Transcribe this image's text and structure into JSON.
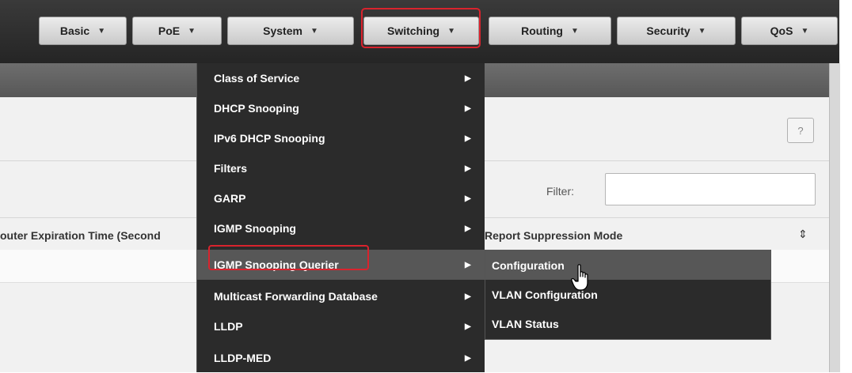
{
  "nav": {
    "tabs": [
      {
        "label": "Basic"
      },
      {
        "label": "PoE"
      },
      {
        "label": "System"
      },
      {
        "label": "Switching"
      },
      {
        "label": "Routing"
      },
      {
        "label": "Security"
      },
      {
        "label": "QoS"
      }
    ],
    "caret_icon": "caret-down-icon"
  },
  "page": {
    "help_label": "?",
    "filter_label": "Filter:",
    "filter_value": "",
    "columns": [
      {
        "label": "outer Expiration Time (Second"
      },
      {
        "label": "Report Suppression Mode"
      }
    ],
    "sort_icon": "sort-icon"
  },
  "menu": {
    "items": [
      {
        "label": "Class of Service"
      },
      {
        "label": "DHCP Snooping"
      },
      {
        "label": "IPv6 DHCP Snooping"
      },
      {
        "label": "Filters"
      },
      {
        "label": "GARP"
      },
      {
        "label": "IGMP Snooping"
      },
      {
        "label": "IGMP Snooping Querier"
      },
      {
        "label": "Multicast Forwarding Database"
      },
      {
        "label": "LLDP"
      },
      {
        "label": "LLDP-MED"
      }
    ],
    "active_item": "IGMP Snooping Querier"
  },
  "submenu": {
    "items": [
      {
        "label": "Configuration"
      },
      {
        "label": "VLAN Configuration"
      },
      {
        "label": "VLAN Status"
      }
    ],
    "active_item": "Configuration"
  },
  "colors": {
    "highlight": "#d9232d",
    "menu_bg": "#2b2b2b",
    "menu_active": "#575757"
  }
}
